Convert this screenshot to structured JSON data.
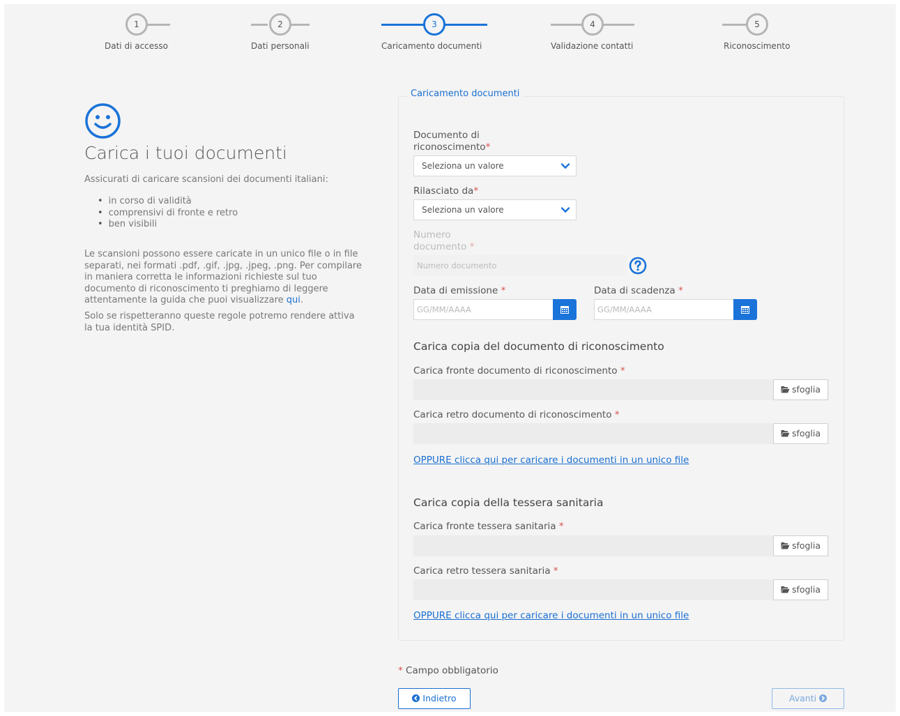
{
  "stepper": {
    "steps": [
      {
        "number": "1",
        "label": "Dati di accesso"
      },
      {
        "number": "2",
        "label": "Dati personali"
      },
      {
        "number": "3",
        "label": "Caricamento documenti",
        "active": true
      },
      {
        "number": "4",
        "label": "Validazione contatti"
      },
      {
        "number": "5",
        "label": "Riconoscimento"
      }
    ]
  },
  "left": {
    "icon": "smiley-icon",
    "title": "Carica i tuoi documenti",
    "intro": "Assicurati di caricare scansioni dei documenti italiani:",
    "bullets": [
      "in corso di validità",
      "comprensivi di fronte e retro",
      "ben visibili"
    ],
    "para_text": "Le scansioni possono essere caricate in un unico file o in file separati, nei formati .pdf, .gif, .jpg, .jpeg, .png. Per compilare in maniera corretta le informazioni richieste sul tuo documento di riconoscimento ti preghiamo di leggere attentamente la guida che puoi visualizzare ",
    "para_link": "qui",
    "para_end": ".",
    "para2": "Solo se rispetteranno queste regole potremo rendere attiva la tua identità SPID."
  },
  "form": {
    "legend": "Caricamento documenti",
    "required_mark": "*",
    "doc_type": {
      "label_line1": "Documento di",
      "label_line2": "riconoscimento",
      "value": "Seleziona un valore"
    },
    "issued_by": {
      "label": "Rilasciato da",
      "value": "Seleziona un valore"
    },
    "doc_number": {
      "label_line1": "Numero",
      "label_line2": "documento",
      "placeholder": "Numero documento",
      "help_icon": "question-circle-icon"
    },
    "issue_date": {
      "label": "Data di emissione",
      "placeholder": "GG/MM/AAAA",
      "icon": "calendar-icon"
    },
    "expiry_date": {
      "label": "Data di scadenza",
      "placeholder": "GG/MM/AAAA",
      "icon": "calendar-icon"
    },
    "id_section": {
      "title": "Carica copia del documento di riconoscimento",
      "front_label": "Carica fronte documento di riconoscimento",
      "back_label": "Carica retro documento di riconoscimento",
      "alt_link": "OPPURE clicca qui per caricare i documenti in un unico file"
    },
    "health_section": {
      "title": "Carica copia della tessera sanitaria",
      "front_label": "Carica fronte tessera sanitaria",
      "back_label": "Carica retro tessera sanitaria",
      "alt_link": "OPPURE clicca qui per caricare i documenti in un unico file"
    },
    "browse_label": "sfoglia",
    "browse_icon": "folder-open-icon"
  },
  "footer": {
    "mandatory_text": "Campo obbligatorio",
    "back_label": "Indietro",
    "back_icon": "arrow-left-circle-icon",
    "next_label": "Avanti",
    "next_icon": "arrow-right-circle-icon"
  },
  "colors": {
    "accent": "#1a73d9",
    "required": "#d9534f",
    "background": "#f4f4f4"
  }
}
